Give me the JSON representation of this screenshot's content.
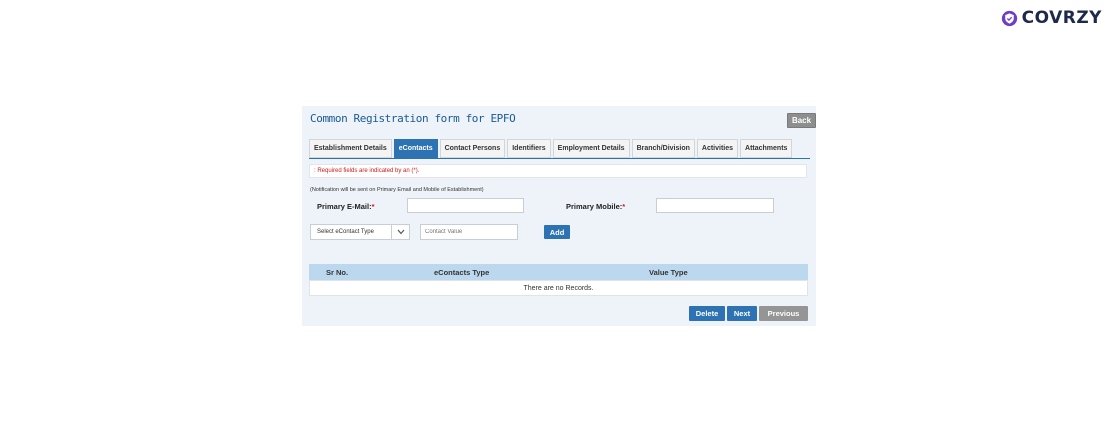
{
  "brand": {
    "name": "COVRZY",
    "icon": "shield-check-icon",
    "color": "#1e2a4a"
  },
  "form": {
    "title": "Common Registration form for EPFO",
    "back_label": "Back",
    "tabs": [
      {
        "label": "Establishment Details",
        "active": false
      },
      {
        "label": "eContacts",
        "active": true
      },
      {
        "label": "Contact Persons",
        "active": false
      },
      {
        "label": "Identifiers",
        "active": false
      },
      {
        "label": "Employment Details",
        "active": false
      },
      {
        "label": "Branch/Division",
        "active": false
      },
      {
        "label": "Activities",
        "active": false
      },
      {
        "label": "Attachments",
        "active": false
      }
    ],
    "required_note": ": Required fields are indicated by an (*).",
    "notification_note": "(Notification will be sent on Primary Email and Mobile of Establishment)",
    "primary_email_label": "Primary E-Mail:",
    "primary_mobile_label": "Primary Mobile:",
    "required_marker": "*",
    "primary_email_value": "",
    "primary_mobile_value": "",
    "econtact_type_selected": "Select eContact Type",
    "contact_value_placeholder": "Contact Value",
    "add_label": "Add",
    "table": {
      "headers": [
        "Sr No.",
        "eContacts Type",
        "Value Type"
      ],
      "empty_message": "There are no Records."
    },
    "delete_label": "Delete",
    "next_label": "Next",
    "previous_label": "Previous"
  },
  "colors": {
    "accent": "#2d72b2",
    "required": "#d11a1a",
    "disabled": "#959595",
    "panel": "#edf3f9"
  }
}
